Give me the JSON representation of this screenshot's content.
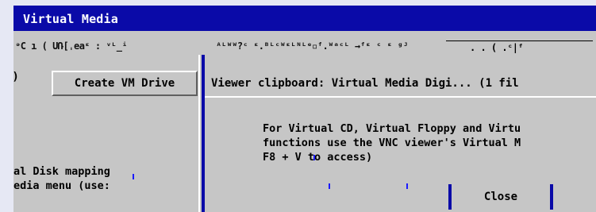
{
  "window": {
    "title": "Virtual Media"
  },
  "garbled_toolbar": {
    "segment_1": "ᵊC ı  ( UՌ[ˌeaᵋ : ᵛᴸ_ⁱ",
    "segment_2": "ᴬᴸᵂᵂ?ᶜ ᵋ.ᴮᴸᶜᵂᵋᴸᴺᴸᵉ▫ᶠ.ᵂᵃᶜᴸ →ᶠᵋ ᶜ ᵋ ᵍᴶ",
    "segment_3": ". . ( .ᶜ|ᶠ"
  },
  "left_panel": {
    "tab_fragment": "e)",
    "create_vm_drive_label": "Create VM Drive",
    "text_line_1": "al Disk mapping",
    "text_line_2": "edia menu (use:"
  },
  "right_panel": {
    "clipboard_text": "Viewer clipboard: Virtual Media Digi... (1 fil",
    "message_line_1": "For Virtual CD, Virtual Floppy and Virtu",
    "message_line_2": "functions use the VNC viewer's Virtual M",
    "message_line_3": "F8 + V to access)",
    "close_label": "Close"
  },
  "colors": {
    "title_bar": "#0a0aa8",
    "panel_background": "#c6c6c6",
    "page_background": "#e6e8f4",
    "accent_blue": "#0a0aa8"
  }
}
